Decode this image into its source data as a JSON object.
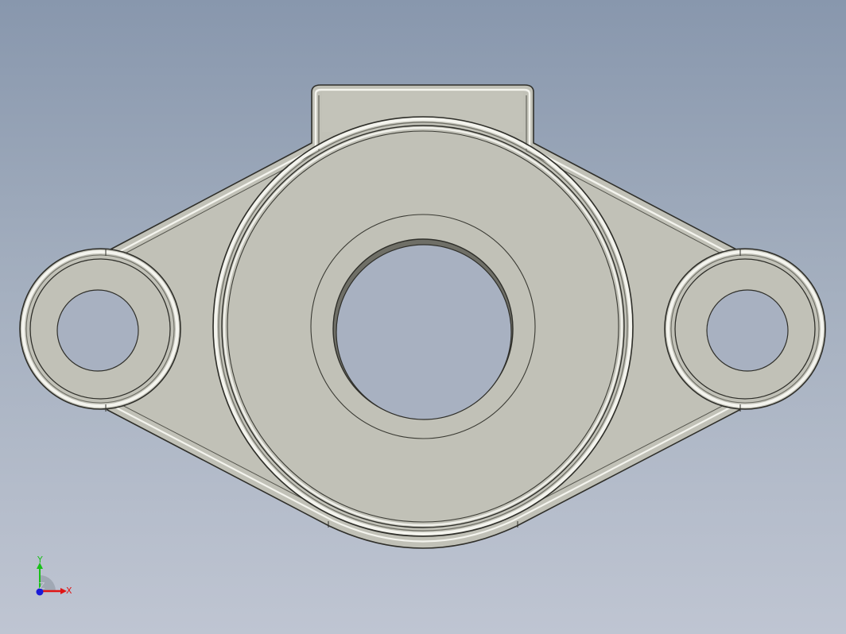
{
  "viewport": {
    "background_top": "#8897ad",
    "background_bottom": "#bfc5d2"
  },
  "part": {
    "face_color": "#c1c1b7",
    "edge_color": "#2f2f2a",
    "fillet_color": "#f4f4ee",
    "shadow_color": "#8e8e84",
    "features": [
      "flange-body",
      "central-boss",
      "center-bore",
      "left-mounting-hole",
      "right-mounting-hole",
      "top-tab"
    ]
  },
  "triad": {
    "x_label": "X",
    "y_label": "Y",
    "z_label": "Z",
    "x_color": "#e01515",
    "y_color": "#18c018",
    "z_color": "#1a1ad8"
  }
}
